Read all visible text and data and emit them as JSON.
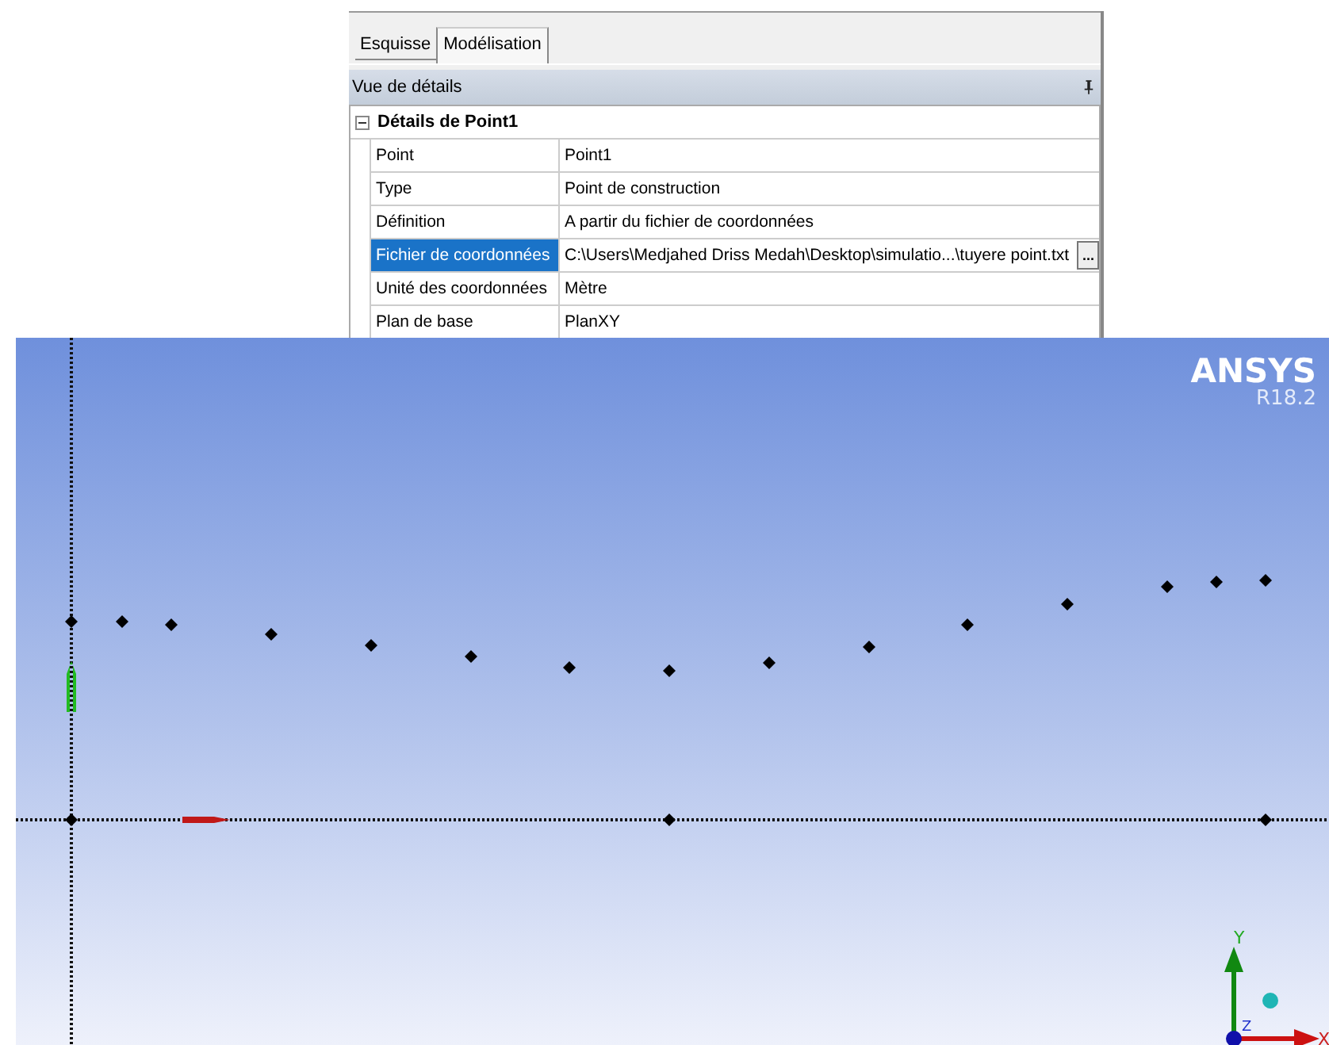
{
  "tabs": [
    {
      "label": "Esquisse",
      "selected": false
    },
    {
      "label": "Modélisation",
      "selected": true
    }
  ],
  "details": {
    "title": "Vue de détails",
    "group": {
      "title": "Détails de Point1",
      "expanded": true,
      "rows": [
        {
          "label": "Point",
          "value": "Point1",
          "selected": false
        },
        {
          "label": "Type",
          "value": "Point de construction",
          "selected": false
        },
        {
          "label": "Définition",
          "value": "A partir du fichier de coordonnées",
          "selected": false
        },
        {
          "label": "Fichier de coordonnées",
          "value": "C:\\Users\\Medjahed Driss Medah\\Desktop\\simulatio...\\tuyere point.txt",
          "selected": true,
          "button": "..."
        },
        {
          "label": "Unité des coordonnées",
          "value": "Mètre",
          "selected": false
        },
        {
          "label": "Plan de base",
          "value": "PlanXY",
          "selected": false
        }
      ]
    }
  },
  "viewport": {
    "logo": "ANSYS",
    "version": "R18.2",
    "triad": {
      "y": "Y",
      "z": "Z",
      "x": "X"
    }
  }
}
